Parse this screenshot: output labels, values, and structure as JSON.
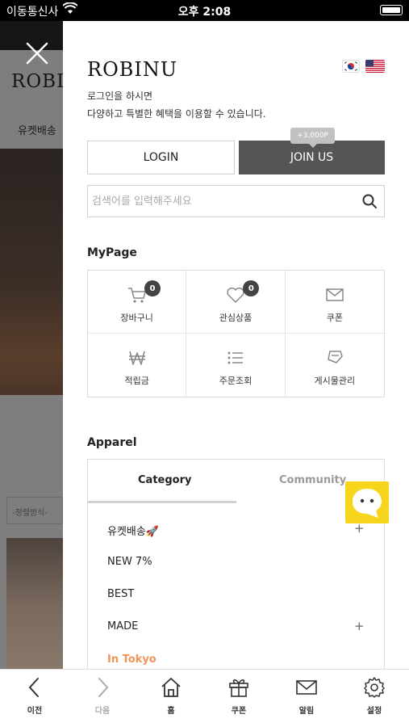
{
  "status_bar": {
    "carrier": "이동통신사",
    "time": "오후 2:08"
  },
  "background_page": {
    "logo": "ROBI",
    "nav_item": "유켓배송",
    "sort_label": "-정렬방식-"
  },
  "drawer": {
    "brand": "ROBINU",
    "greeting_line1": "로그인을 하시면",
    "greeting_line2": "다양하고 특별한 혜택을 이용할 수 있습니다.",
    "login_label": "LOGIN",
    "join_label": "JOIN US",
    "join_bonus": "+3,000P",
    "search_placeholder": "검색어를 입력해주세요",
    "mypage": {
      "title": "MyPage",
      "items": [
        {
          "label": "장바구니",
          "icon": "cart-icon",
          "badge": "0"
        },
        {
          "label": "관심상품",
          "icon": "heart-icon",
          "badge": "0"
        },
        {
          "label": "쿠폰",
          "icon": "mail-icon"
        },
        {
          "label": "적립금",
          "icon": "won-icon"
        },
        {
          "label": "주문조회",
          "icon": "list-icon"
        },
        {
          "label": "게시물관리",
          "icon": "board-icon"
        }
      ]
    },
    "apparel": {
      "title": "Apparel",
      "tabs": [
        "Category",
        "Community"
      ],
      "items": [
        {
          "label": "유켓배송🚀",
          "expandable": true
        },
        {
          "label": "NEW 7%",
          "expandable": false
        },
        {
          "label": "BEST",
          "expandable": false
        },
        {
          "label": "MADE",
          "expandable": true
        },
        {
          "label": "In Tokyo",
          "expandable": false,
          "color": "#f0955a"
        }
      ]
    }
  },
  "tab_bar": [
    {
      "label": "이전",
      "icon": "back-icon"
    },
    {
      "label": "다음",
      "icon": "forward-icon",
      "disabled": true
    },
    {
      "label": "홈",
      "icon": "home-icon"
    },
    {
      "label": "쿠폰",
      "icon": "gift-icon"
    },
    {
      "label": "알림",
      "icon": "mail-icon"
    },
    {
      "label": "설정",
      "icon": "gear-icon"
    }
  ],
  "colors": {
    "join_bg": "#555555",
    "accent_orange": "#f0955a",
    "chat_yellow": "#f7d51c"
  }
}
